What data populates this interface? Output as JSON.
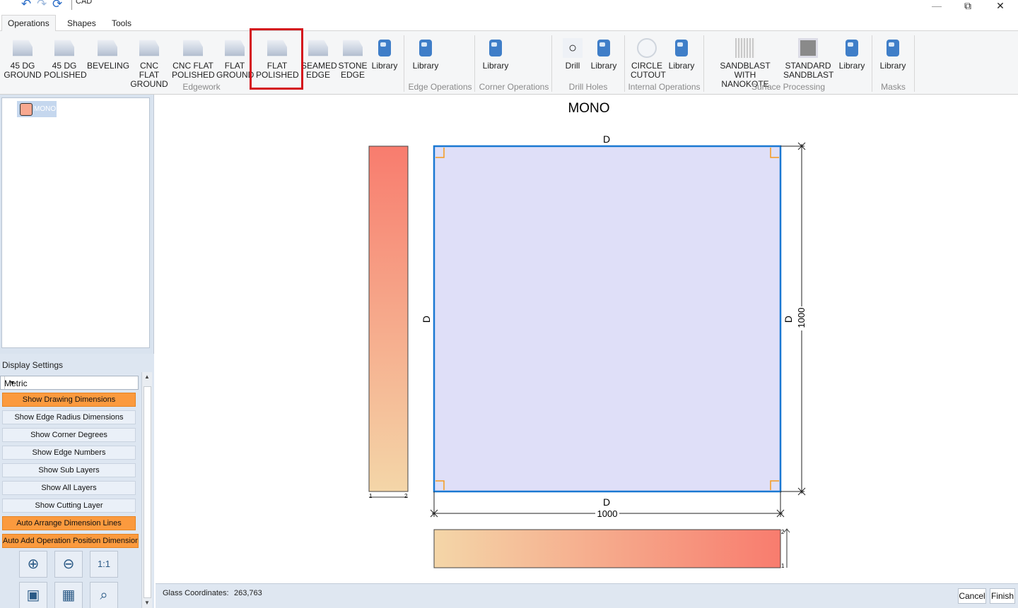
{
  "window": {
    "title": "CAD",
    "controls": {
      "minimize": "—",
      "restore": "⧉",
      "close": "✕"
    }
  },
  "quick_access": {
    "undo": "↶",
    "redo": "↷",
    "refresh": "⟳"
  },
  "tabs": [
    {
      "label": "Operations",
      "active": true
    },
    {
      "label": "Shapes",
      "active": false
    },
    {
      "label": "Tools",
      "active": false
    }
  ],
  "ribbon": {
    "edgework": {
      "group_label": "Edgework",
      "buttons": [
        {
          "line1": "45 DG",
          "line2": "GROUND"
        },
        {
          "line1": "45 DG",
          "line2": "POLISHED"
        },
        {
          "line1": "BEVELING",
          "line2": ""
        },
        {
          "line1": "CNC FLAT",
          "line2": "GROUND"
        },
        {
          "line1": "CNC FLAT",
          "line2": "POLISHED"
        },
        {
          "line1": "FLAT",
          "line2": "GROUND"
        },
        {
          "line1": "FLAT",
          "line2": "POLISHED"
        },
        {
          "line1": "SEAMED",
          "line2": "EDGE"
        },
        {
          "line1": "STONE",
          "line2": "EDGE"
        },
        {
          "line1": "Library",
          "line2": ""
        }
      ]
    },
    "edge_operations": {
      "group_label": "Edge Operations",
      "library": "Library"
    },
    "corner_operations": {
      "group_label": "Corner Operations",
      "library": "Library"
    },
    "drill_holes": {
      "group_label": "Drill Holes",
      "drill": "Drill",
      "library": "Library"
    },
    "internal_operations": {
      "group_label": "Internal Operations",
      "circle_line1": "CIRCLE",
      "circle_line2": "CUTOUT",
      "library": "Library"
    },
    "surface_processing": {
      "group_label": "Surface Processing",
      "sandblast_nano_line1": "SANDBLAST WITH",
      "sandblast_nano_line2": "NANOKOTE",
      "standard_line1": "STANDARD",
      "standard_line2": "SANDBLAST",
      "library": "Library"
    },
    "masks": {
      "group_label": "Masks",
      "library": "Library"
    },
    "highlighted_button": "FLAT POLISHED"
  },
  "tree": {
    "item_label": "MONO"
  },
  "display_settings": {
    "title": "Display Settings",
    "unit_select": "Metric",
    "options": [
      {
        "label": "Show Drawing Dimensions",
        "on": true
      },
      {
        "label": "Show Edge Radius Dimensions",
        "on": false
      },
      {
        "label": "Show Corner Degrees",
        "on": false
      },
      {
        "label": "Show Edge Numbers",
        "on": false
      },
      {
        "label": "Show Sub Layers",
        "on": false
      },
      {
        "label": "Show All Layers",
        "on": false
      },
      {
        "label": "Show Cutting Layer",
        "on": false
      },
      {
        "label": "Auto Arrange Dimension Lines",
        "on": true
      },
      {
        "label": "Auto Add Operation Position Dimension",
        "on": true
      }
    ]
  },
  "drawing": {
    "title": "MONO",
    "edge_top": "D",
    "edge_bottom": "D",
    "edge_left": "D",
    "edge_right": "D",
    "width_dim": "1000",
    "height_dim": "1000",
    "left_bar_tick_a": "1",
    "left_bar_tick_b": "2",
    "bottom_bar_tick_a": "2",
    "bottom_bar_tick_b": "1",
    "colors": {
      "glass_fill": "#dfdff8",
      "glass_stroke": "#1a78d2",
      "corner": "#f59a1c",
      "gradient_start": "#f4d6a8",
      "gradient_end": "#f87c6e"
    }
  },
  "status": {
    "label": "Glass Coordinates:",
    "value": "263,763",
    "cancel": "Cancel",
    "finish": "Finish"
  }
}
